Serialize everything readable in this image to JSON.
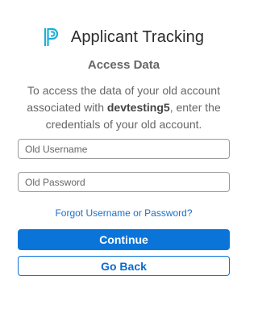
{
  "header": {
    "logo_icon": "applicant-tracking-logo-icon",
    "title": "Applicant Tracking",
    "logo_color": "#1ab0d6"
  },
  "main": {
    "subtitle": "Access Data",
    "description_before": "To access the data of your old account associated with ",
    "account_name": "devtesting5",
    "description_after": ", enter the credentials of your old account.",
    "username_placeholder": "Old Username",
    "username_value": "",
    "password_placeholder": "Old Password",
    "password_value": "",
    "forgot_link": "Forgot Username or Password?",
    "continue_label": "Continue",
    "back_label": "Go Back"
  },
  "colors": {
    "primary": "#0a74d9",
    "link": "#1a6fc9"
  }
}
